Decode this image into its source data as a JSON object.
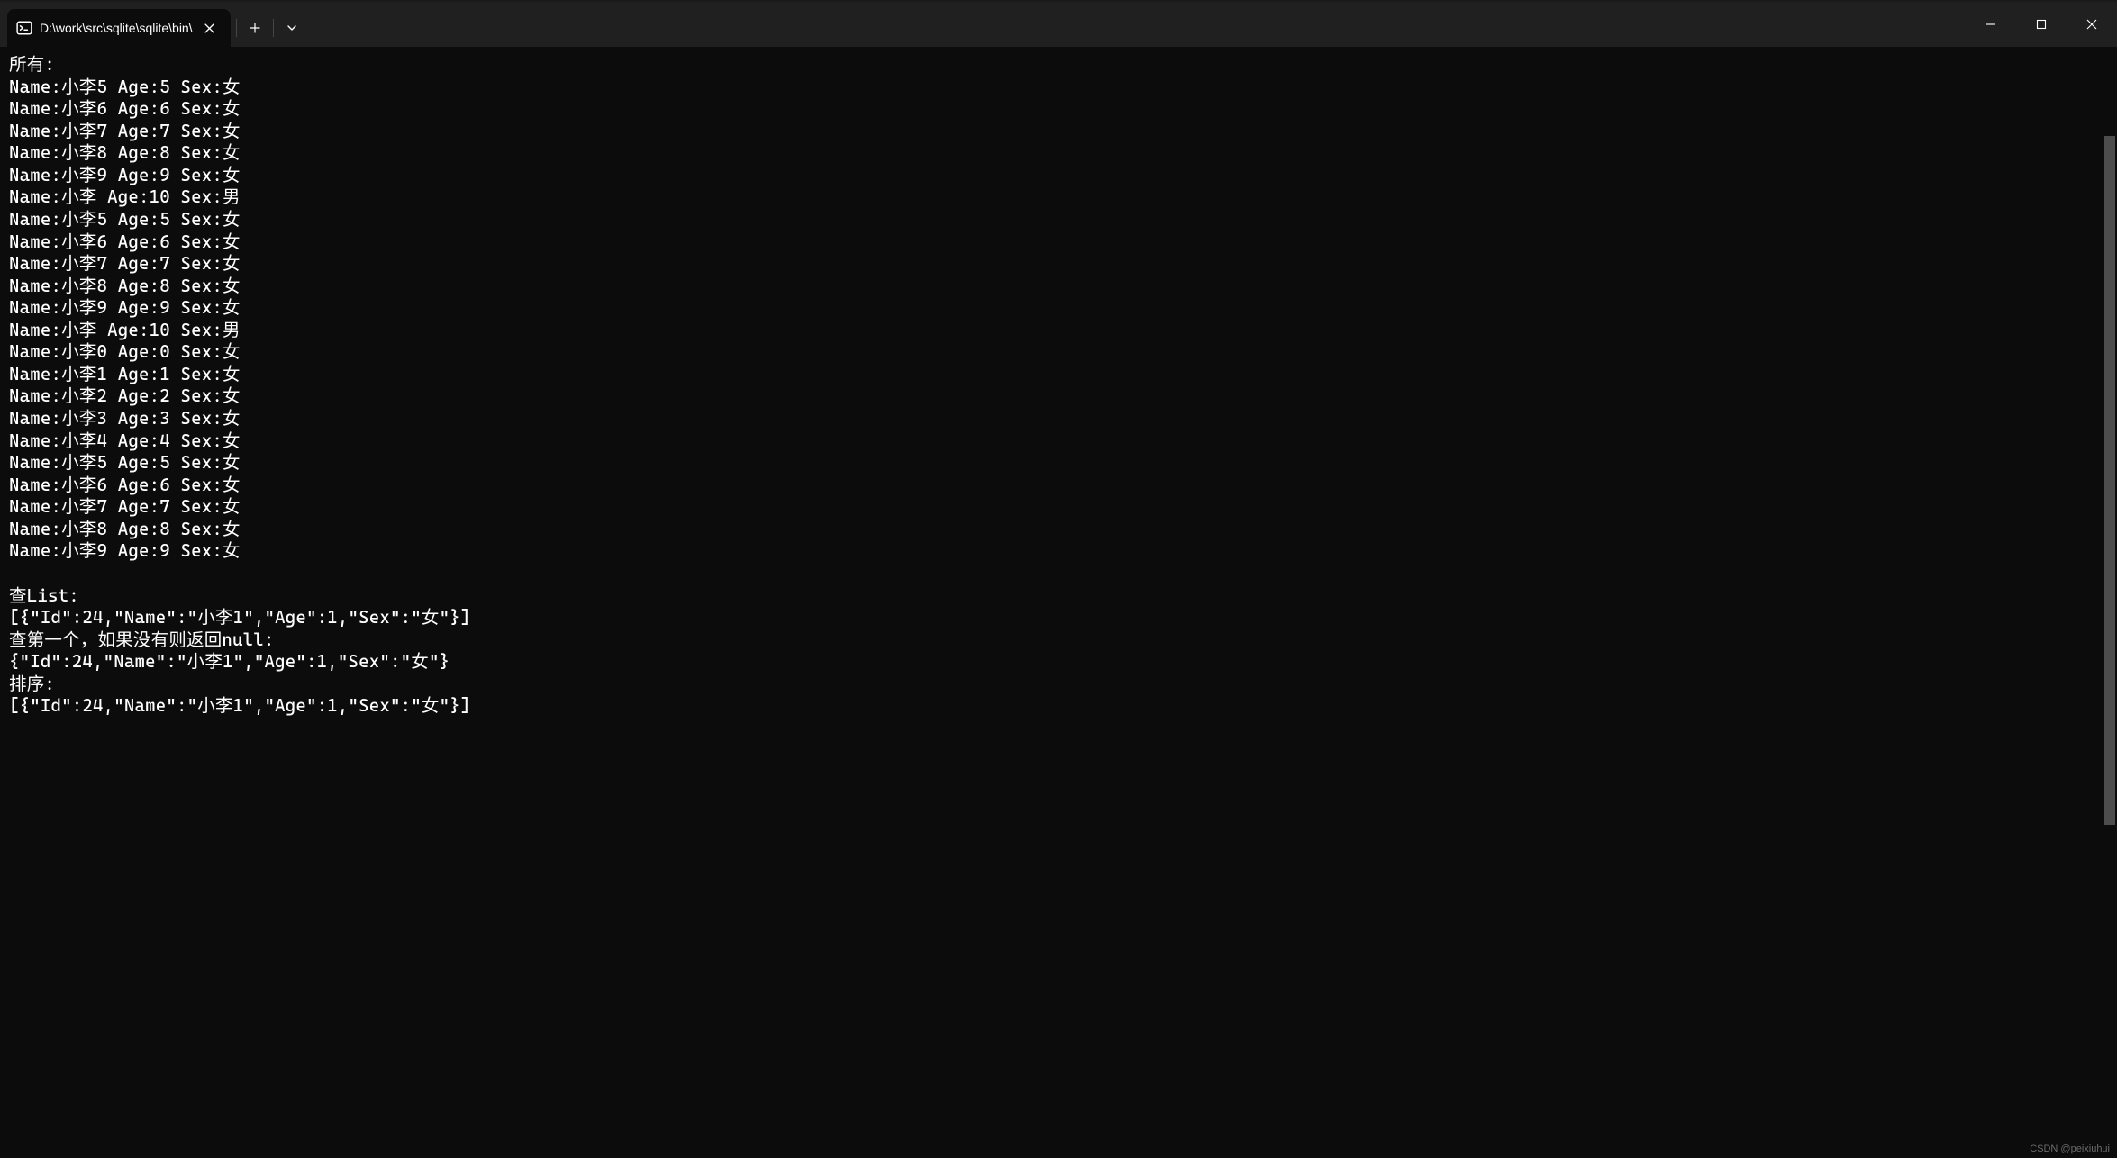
{
  "tab": {
    "title": "D:\\work\\src\\sqlite\\sqlite\\bin\\"
  },
  "terminal": {
    "lines": [
      "所有:",
      "Name:小李5 Age:5 Sex:女",
      "Name:小李6 Age:6 Sex:女",
      "Name:小李7 Age:7 Sex:女",
      "Name:小李8 Age:8 Sex:女",
      "Name:小李9 Age:9 Sex:女",
      "Name:小李 Age:10 Sex:男",
      "Name:小李5 Age:5 Sex:女",
      "Name:小李6 Age:6 Sex:女",
      "Name:小李7 Age:7 Sex:女",
      "Name:小李8 Age:8 Sex:女",
      "Name:小李9 Age:9 Sex:女",
      "Name:小李 Age:10 Sex:男",
      "Name:小李0 Age:0 Sex:女",
      "Name:小李1 Age:1 Sex:女",
      "Name:小李2 Age:2 Sex:女",
      "Name:小李3 Age:3 Sex:女",
      "Name:小李4 Age:4 Sex:女",
      "Name:小李5 Age:5 Sex:女",
      "Name:小李6 Age:6 Sex:女",
      "Name:小李7 Age:7 Sex:女",
      "Name:小李8 Age:8 Sex:女",
      "Name:小李9 Age:9 Sex:女",
      "",
      "查List:",
      "[{\"Id\":24,\"Name\":\"小李1\",\"Age\":1,\"Sex\":\"女\"}]",
      "查第一个，如果没有则返回null:",
      "{\"Id\":24,\"Name\":\"小李1\",\"Age\":1,\"Sex\":\"女\"}",
      "排序:",
      "[{\"Id\":24,\"Name\":\"小李1\",\"Age\":1,\"Sex\":\"女\"}]"
    ]
  },
  "watermark": "CSDN @peixiuhui",
  "scrollbar": {
    "top_pct": 8,
    "height_pct": 62
  }
}
